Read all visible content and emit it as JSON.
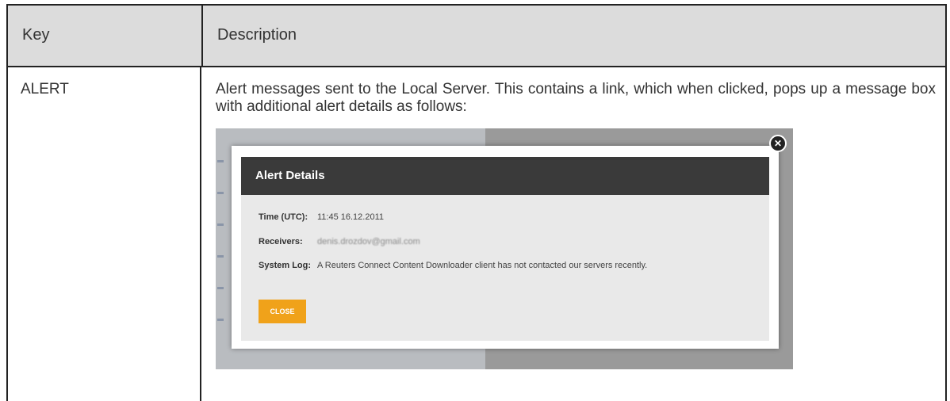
{
  "table": {
    "headers": {
      "key": "Key",
      "description": "Description"
    },
    "rows": [
      {
        "key": "ALERT",
        "description": "Alert messages sent to the Local Server. This contains a link, which when clicked, pops up a message box with additional alert details as follows:"
      }
    ]
  },
  "screenshot": {
    "dialog_title": "Alert Details",
    "fields": {
      "time_label": "Time (UTC):",
      "time_value": "11:45 16.12.2011",
      "receivers_label": "Receivers:",
      "receivers_value": "denis.drozdov@gmail.com",
      "system_log_label": "System Log:",
      "system_log_value": "A Reuters Connect Content Downloader client has not contacted our servers recently."
    },
    "close_button_label": "CLOSE",
    "close_icon_glyph": "✕",
    "colors": {
      "titlebar": "#3a3a3a",
      "close_button": "#f0a21a",
      "header_row": "#dcdcdc"
    }
  }
}
